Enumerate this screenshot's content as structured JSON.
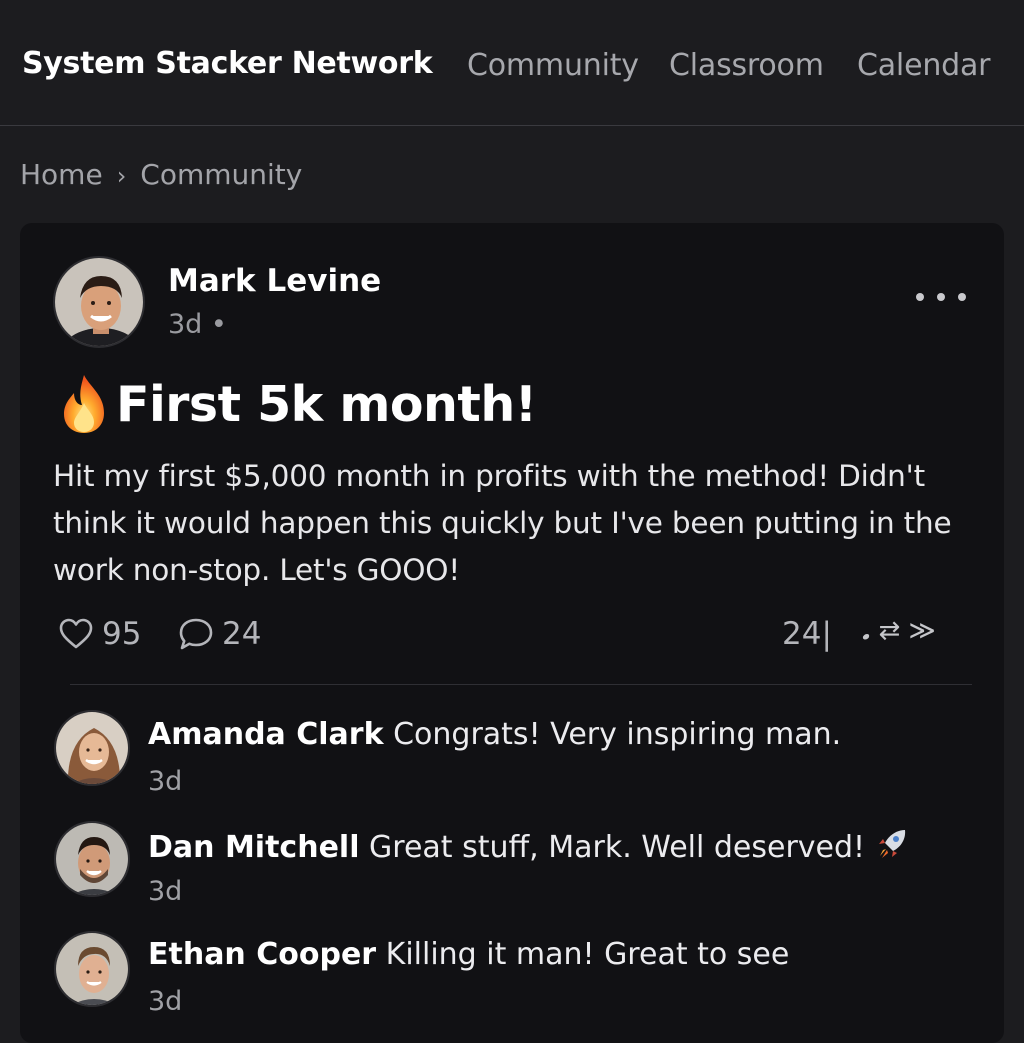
{
  "header": {
    "brand": "System Stacker Network",
    "nav": [
      "Community",
      "Classroom",
      "Calendar"
    ]
  },
  "breadcrumb": {
    "home": "Home",
    "separator": "›",
    "current": "Community"
  },
  "post": {
    "author": "Mark Levine",
    "time": "3d •",
    "title": "First 5k month!",
    "title_icon": "fire-emoji",
    "body_lines": [
      "Hit my first $5,000 month in profits with the method! Didn't",
      "think it would happen this quickly but I've been putting in the",
      "work non-stop. Let's GOOO!"
    ],
    "likes": "95",
    "comments": "24",
    "right_stat": "24|",
    "right_glyphs": "𝅘 ⇄ ≫"
  },
  "comments": [
    {
      "name": "Amanda Clark",
      "text": "Congrats! Very inspiring man.",
      "time": "3d"
    },
    {
      "name": "Dan Mitchell",
      "text": "Great stuff, Mark. Well deserved!",
      "time": "3d",
      "emoji": "rocket-emoji"
    },
    {
      "name": "Ethan Cooper",
      "text": "Killing it man! Great to see",
      "time": "3d"
    }
  ],
  "colors": {
    "background": "#1c1c1f",
    "card": "#111114",
    "text_primary": "#ffffff",
    "text_muted": "#a3a4a9"
  }
}
